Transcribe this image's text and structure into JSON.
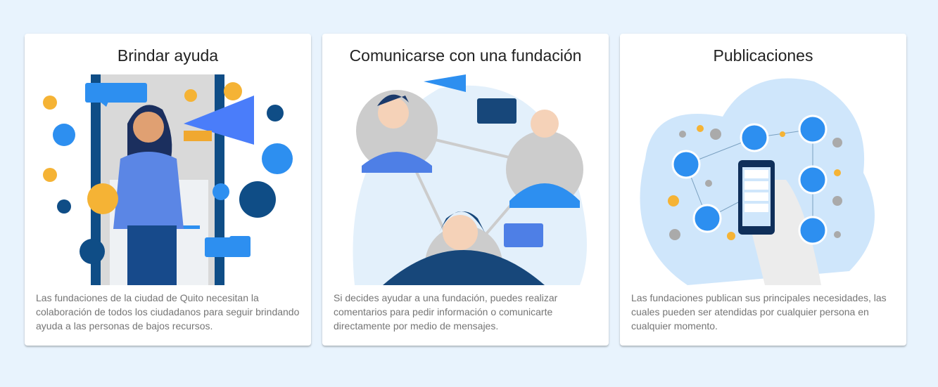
{
  "cards": [
    {
      "title": "Brindar ayuda",
      "description": "Las fundaciones de la ciudad de Quito necesitan la colaboración de todos los ciudadanos para seguir brindando ayuda a las personas de bajos recursos.",
      "image": "megaphone-woman-illustration"
    },
    {
      "title": "Comunicarse con una fundación",
      "description": "Si decides ayudar a una fundación, puedes realizar comentarios para pedir información o comunicarte directamente por medio de mensajes.",
      "image": "people-network-illustration"
    },
    {
      "title": "Publicaciones",
      "description": "Las fundaciones publican sus principales necesidades, las cuales pueden ser atendidas por cualquier persona en cualquier momento.",
      "image": "phone-network-illustration"
    }
  ],
  "colors": {
    "background": "#e8f3fd",
    "accent": "#2d8ff0",
    "dark_blue": "#0f4d86"
  }
}
